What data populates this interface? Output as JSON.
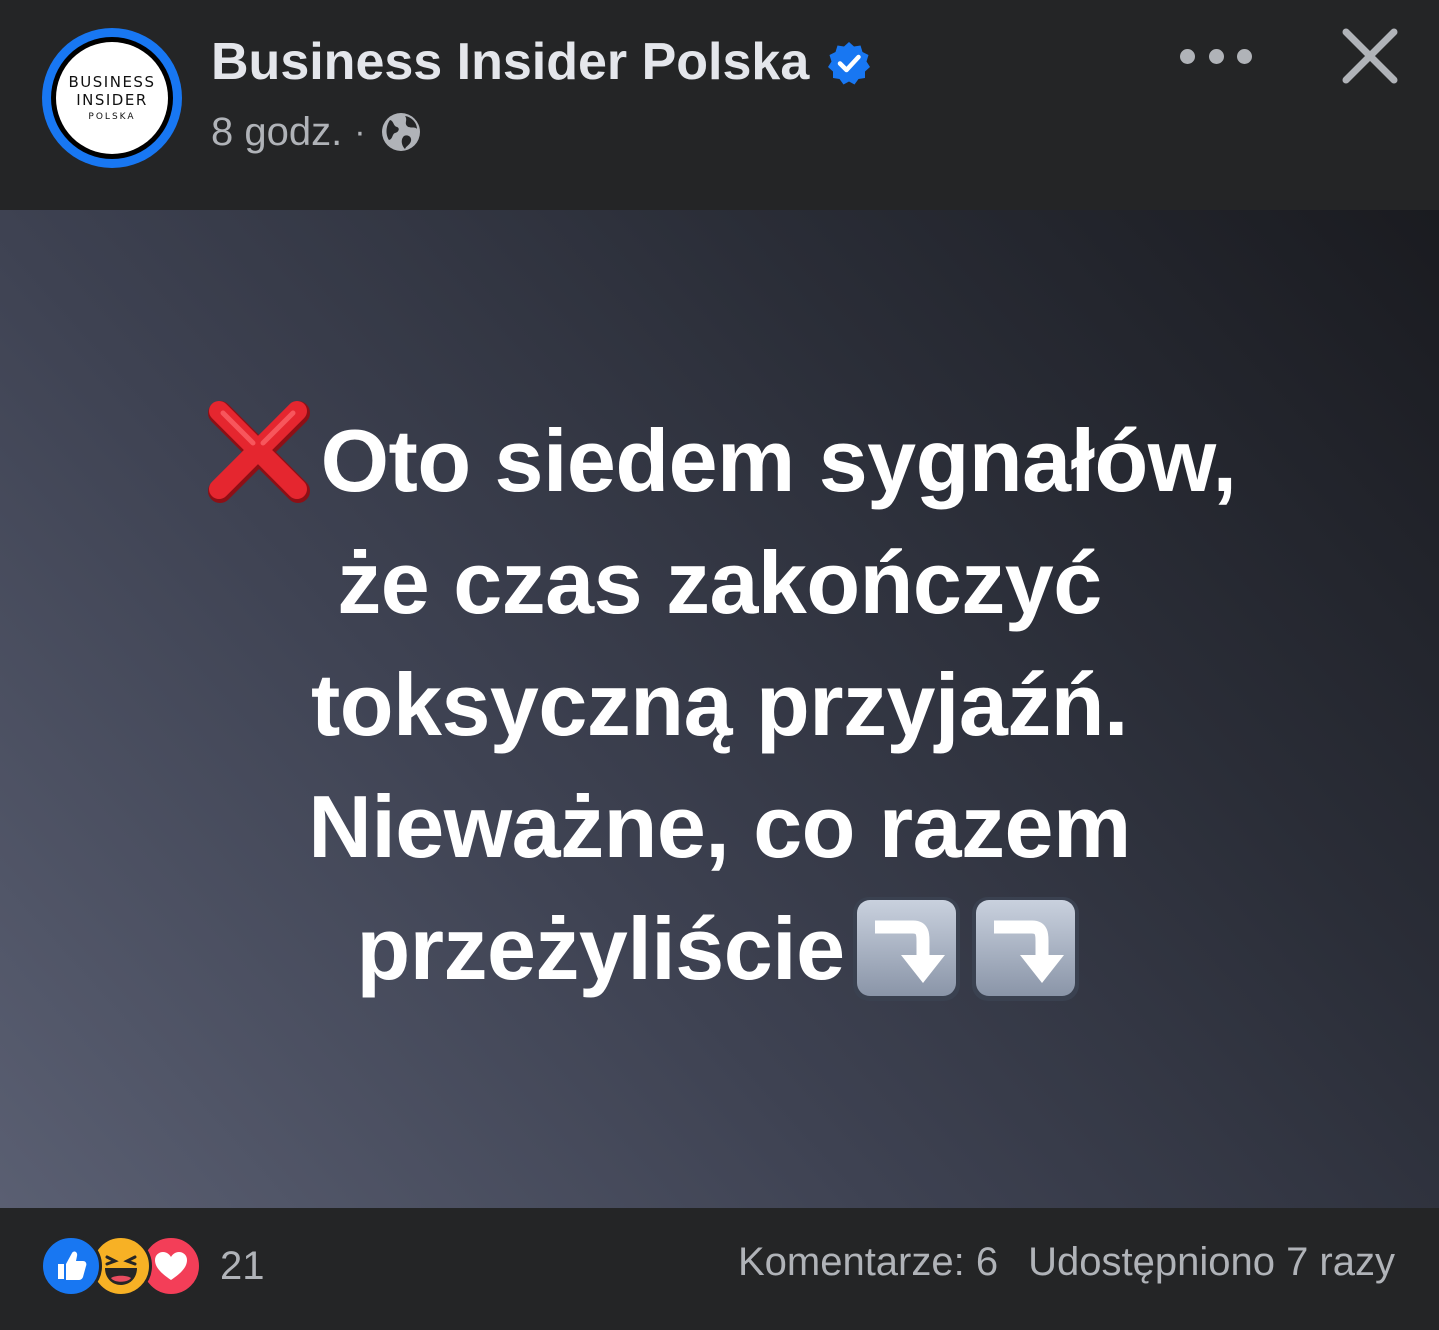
{
  "header": {
    "page_name": "Business Insider Polska",
    "time": "8 godz.",
    "separator": "·",
    "logo": {
      "line1": "BUSINESS",
      "line2": "INSIDER",
      "line3": "POLSKA"
    }
  },
  "post": {
    "lines": [
      "Oto siedem sygnałów,",
      "że czas zakończyć",
      "toksyczną przyjaźń.",
      "Nieważne, co razem",
      "przeżyliście"
    ],
    "leading_emoji": "cross-mark-icon",
    "trailing_emoji": [
      "arrow-right-curving-down-icon",
      "arrow-right-curving-down-icon"
    ],
    "background_colors": [
      "#5a5f72",
      "#1a1b20"
    ]
  },
  "footer": {
    "reactions": [
      "like-icon",
      "haha-icon",
      "love-icon"
    ],
    "reaction_count": "21",
    "comments": "Komentarze: 6",
    "shares": "Udostępniono 7 razy"
  },
  "colors": {
    "background": "#242526",
    "accent": "#1877f2",
    "text_primary": "#e4e6eb",
    "text_secondary": "#b0b3b8"
  }
}
